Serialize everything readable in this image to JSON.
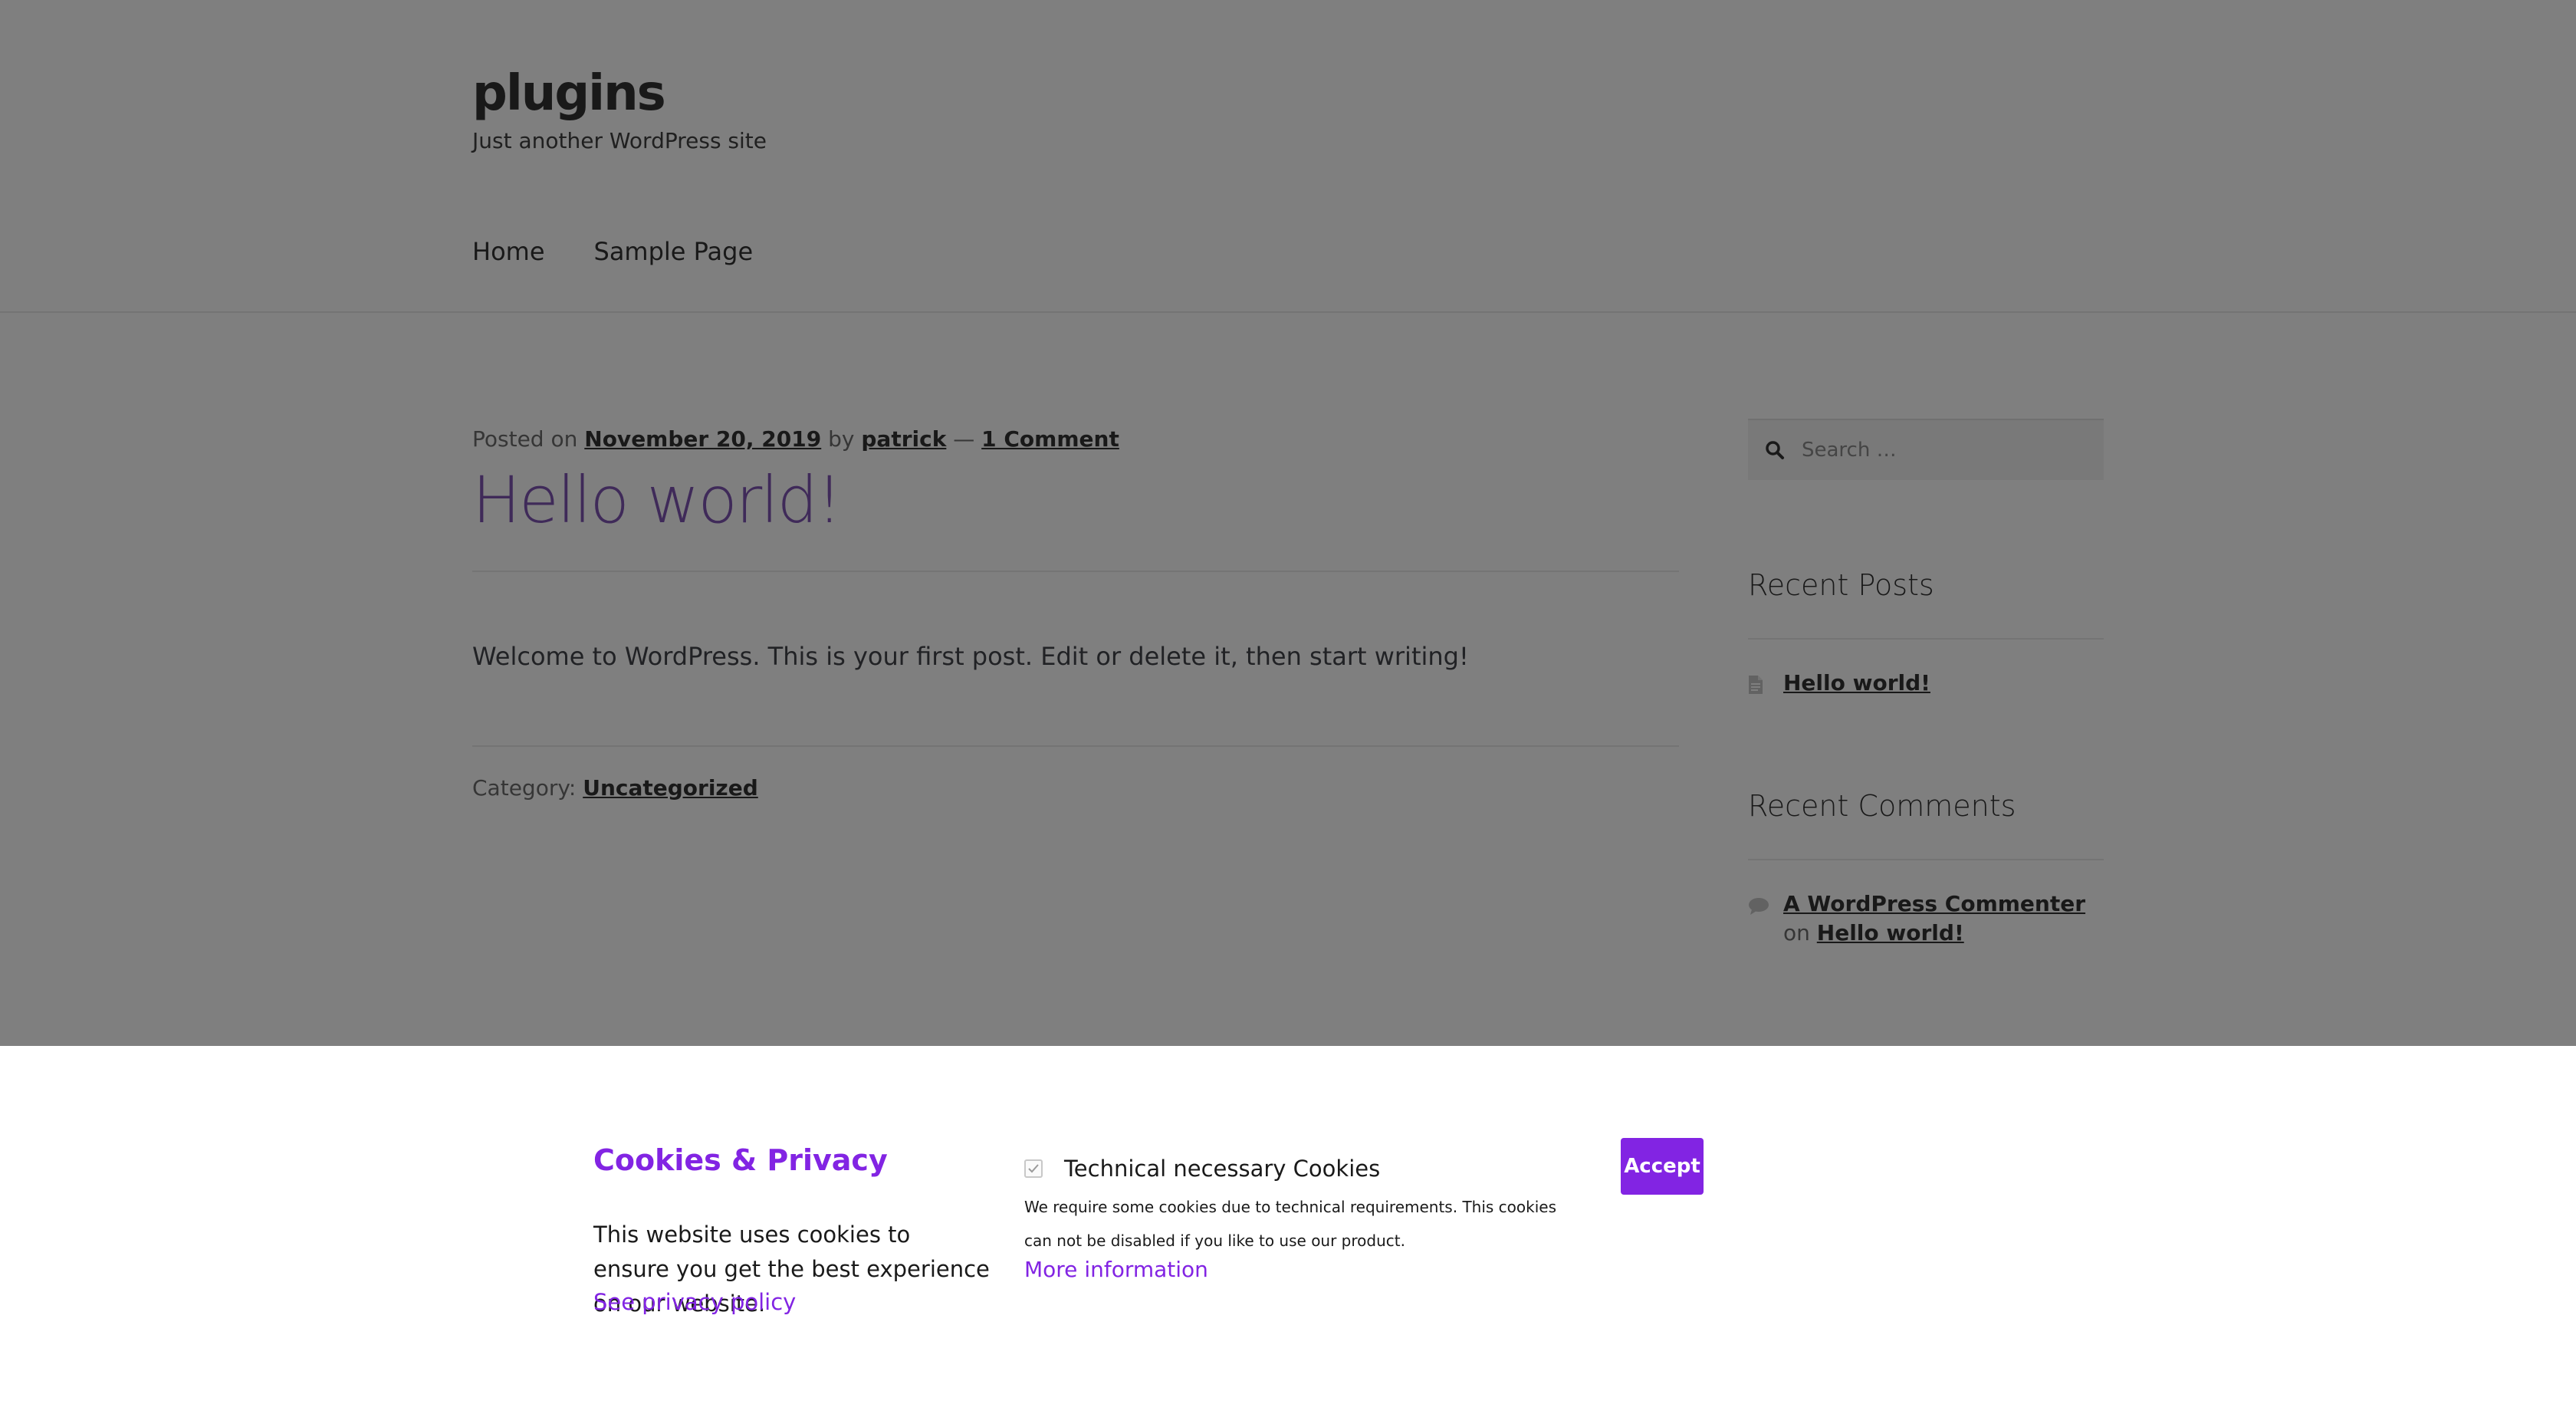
{
  "site": {
    "title": "plugins",
    "tagline": "Just another WordPress site",
    "nav": [
      {
        "label": "Home"
      },
      {
        "label": "Sample Page"
      }
    ]
  },
  "post": {
    "meta_prefix": "Posted on ",
    "date": "November 20, 2019",
    "by": " by ",
    "author": "patrick",
    "dash": " — ",
    "comments": "1 Comment",
    "title": "Hello world!",
    "content": "Welcome to WordPress. This is your first post. Edit or delete it, then start writing!",
    "category_label": "Category: ",
    "category": "Uncategorized"
  },
  "sidebar": {
    "search_placeholder": "Search …",
    "recent_posts_title": "Recent Posts",
    "recent_posts": [
      {
        "label": "Hello world!"
      }
    ],
    "recent_comments_title": "Recent Comments",
    "recent_comments": [
      {
        "author": "A WordPress Commenter",
        "on": " on ",
        "post": "Hello world!"
      }
    ]
  },
  "cookie_banner": {
    "title": "Cookies & Privacy",
    "text": "This website uses cookies to ensure you get the best experience on our website.",
    "policy_link": "See privacy policy",
    "technical_label": "Technical necessary Cookies",
    "technical_checked": true,
    "technical_desc": "We require some cookies due to technical requirements. This cookies can not be disabled if you like to use our product.",
    "more_info": "More information",
    "accept_label": "Accept"
  },
  "colors": {
    "accent": "#8224e3",
    "post_title": "#7f54b3",
    "overlay": "rgba(0,0,0,0.5)"
  }
}
